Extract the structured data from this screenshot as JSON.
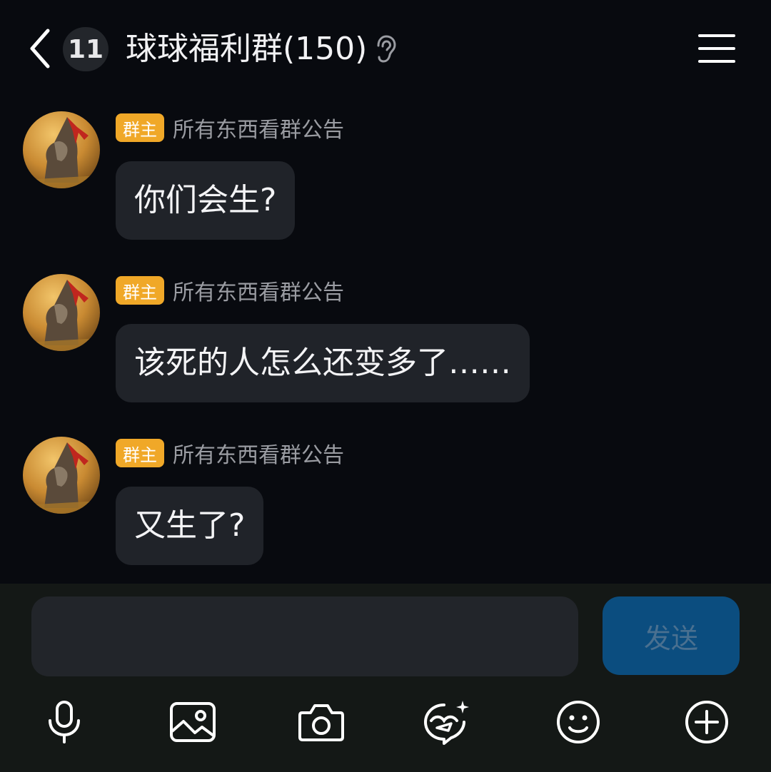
{
  "header": {
    "unread_count": "11",
    "title": "球球福利群(150)"
  },
  "messages": [
    {
      "role": "群主",
      "sender": "所有东西看群公告",
      "text": "你们会生?"
    },
    {
      "role": "群主",
      "sender": "所有东西看群公告",
      "text": "该死的人怎么还变多了……"
    },
    {
      "role": "群主",
      "sender": "所有东西看群公告",
      "text": "又生了?"
    }
  ],
  "composer": {
    "input_value": "",
    "placeholder": "",
    "send_label": "发送"
  },
  "toolbar": {
    "items": [
      "mic-icon",
      "image-icon",
      "camera-icon",
      "sticker-icon",
      "emoji-icon",
      "plus-icon"
    ]
  },
  "colors": {
    "background": "#080a0f",
    "bubble": "#202329",
    "role_badge": "#f0a828",
    "send_button": "#0b4d7f",
    "input_area": "#141816"
  }
}
